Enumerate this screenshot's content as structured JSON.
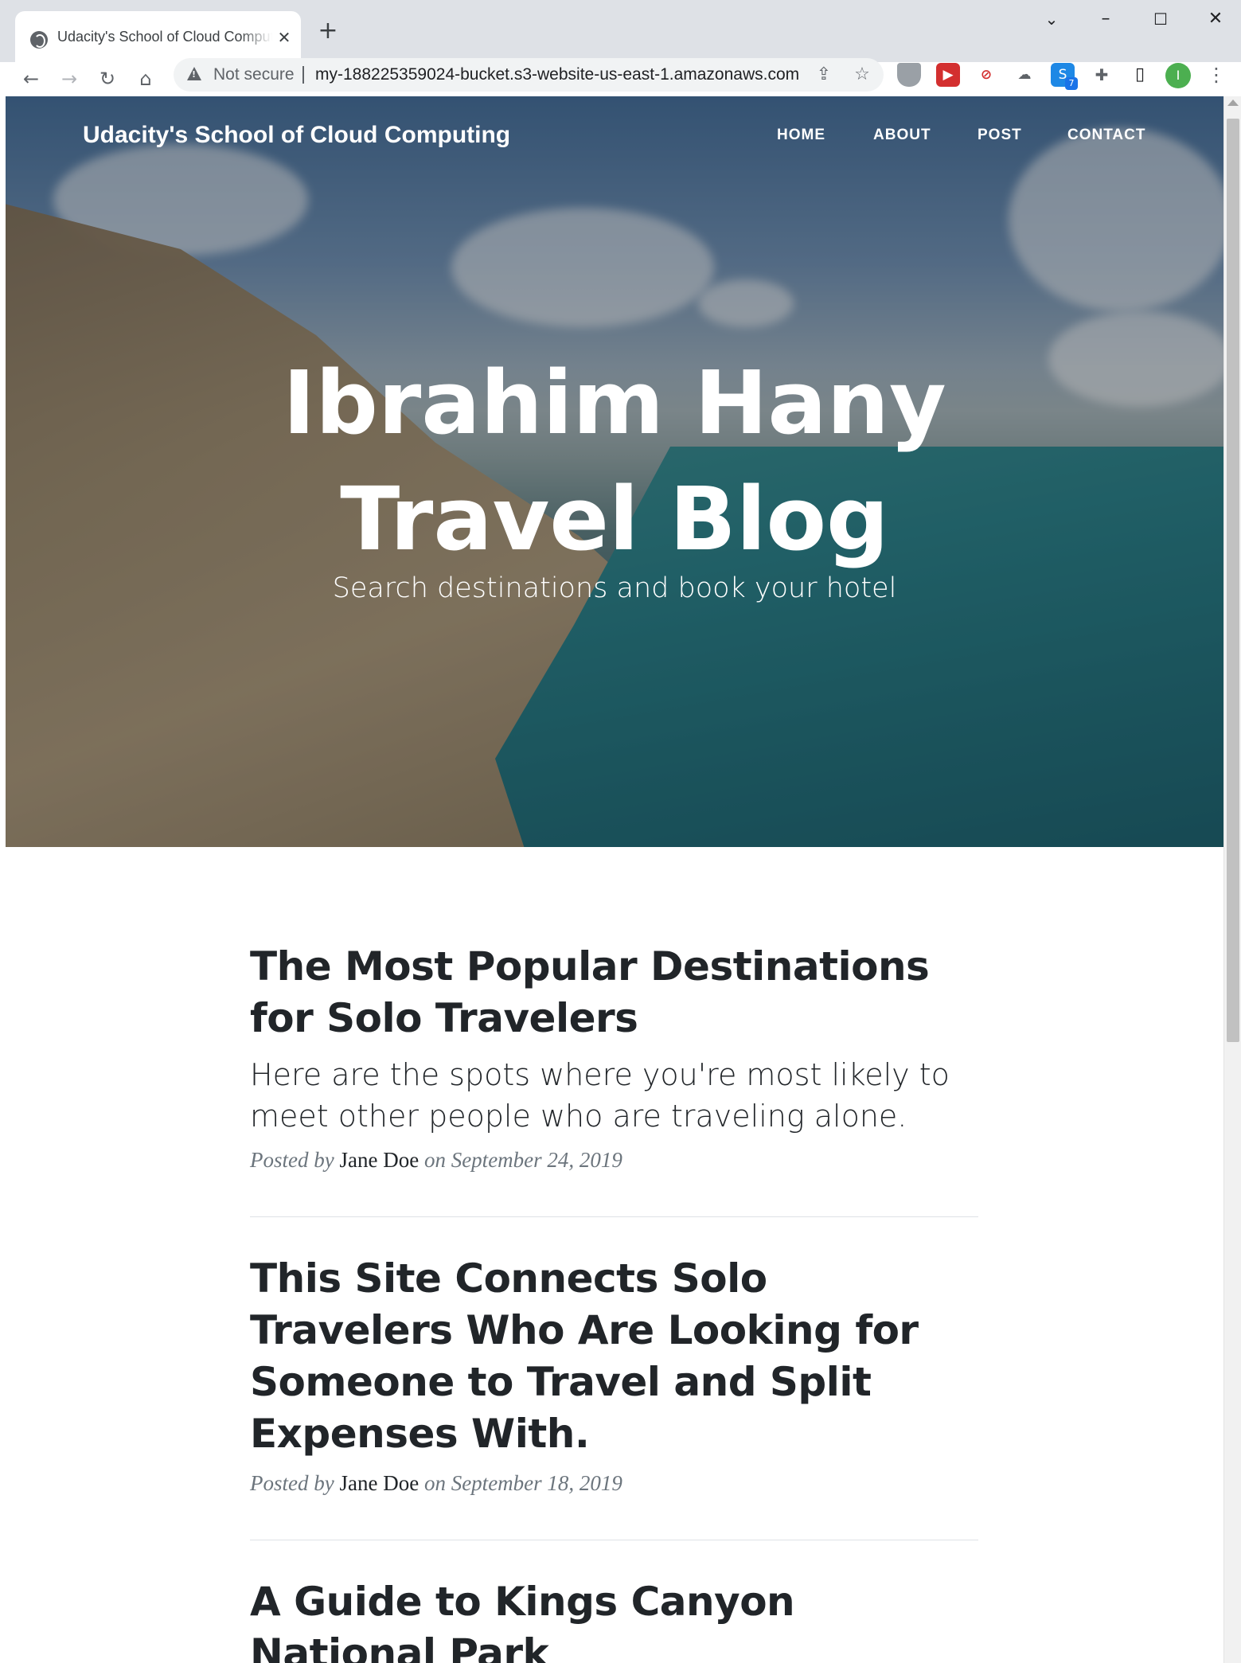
{
  "browser": {
    "tab_title": "Udacity's School of Cloud Computing",
    "tab_close": "✕",
    "new_tab": "+",
    "security_label": "Not secure",
    "url": "my-188225359024-bucket.s3-website-us-east-1.amazonaws.com",
    "extension_badge": "7",
    "profile_initial": "I",
    "window_controls": {
      "tab_search": "⌄",
      "minimize": "–",
      "maximize": "☐",
      "close": "✕"
    },
    "nav": {
      "back": "←",
      "forward": "→",
      "reload": "↻",
      "home": "⌂"
    },
    "omnibox_actions": {
      "share": "⇪",
      "bookmark": "☆"
    },
    "toolbar_glyphs": {
      "side_panel": "▯",
      "menu": "⋮",
      "puzzle": "✚"
    }
  },
  "site": {
    "brand": "Udacity's School of Cloud Computing",
    "nav": [
      {
        "label": "HOME"
      },
      {
        "label": "ABOUT"
      },
      {
        "label": "POST"
      },
      {
        "label": "CONTACT"
      }
    ],
    "hero": {
      "title_line1": "Ibrahim Hany",
      "title_line2": "Travel Blog",
      "subtitle": "Search destinations and book your hotel"
    },
    "posts": [
      {
        "title": "The Most Popular Destinations for Solo Travelers",
        "subtitle": "Here are the spots where you're most likely to meet other people who are traveling alone.",
        "meta_prefix": "Posted by",
        "author": "Jane Doe",
        "meta_on": "on September 24, 2019"
      },
      {
        "title": "This Site Connects Solo Travelers Who Are Looking for Someone to Travel and Split Expenses With.",
        "meta_prefix": "Posted by",
        "author": "Jane Doe",
        "meta_on": "on September 18, 2019"
      },
      {
        "title": "A Guide to Kings Canyon National Park"
      }
    ]
  },
  "colors": {
    "heading_text": "#212529",
    "meta_text": "#6c757d",
    "divider": "#dee2e6",
    "tabstrip_bg": "#dee1e6"
  }
}
